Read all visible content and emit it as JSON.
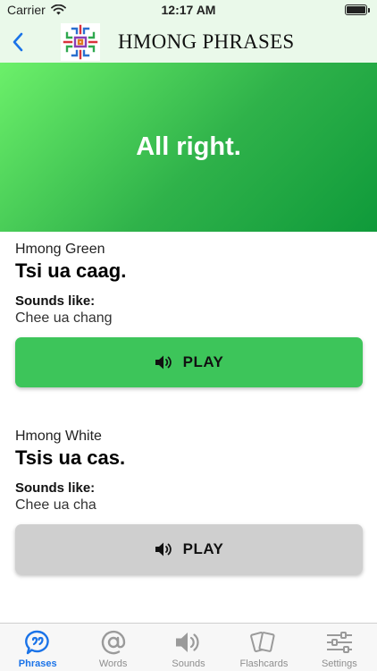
{
  "status_bar": {
    "carrier": "Carrier",
    "time": "12:17 AM"
  },
  "nav": {
    "title": "HMONG PHRASES"
  },
  "hero": {
    "phrase": "All right."
  },
  "sections": [
    {
      "dialect": "Hmong Green",
      "phrase": "Tsi ua caag.",
      "sounds_like_label": "Sounds like:",
      "sounds_like": "Chee ua chang",
      "play_label": "PLAY"
    },
    {
      "dialect": "Hmong White",
      "phrase": "Tsis ua cas.",
      "sounds_like_label": "Sounds like:",
      "sounds_like": "Chee ua cha",
      "play_label": "PLAY"
    }
  ],
  "tabs": [
    {
      "label": "Phrases",
      "icon": "chat-bubble-icon",
      "active": true
    },
    {
      "label": "Words",
      "icon": "at-sign-icon",
      "active": false
    },
    {
      "label": "Sounds",
      "icon": "speaker-icon",
      "active": false
    },
    {
      "label": "Flashcards",
      "icon": "cards-icon",
      "active": false
    },
    {
      "label": "Settings",
      "icon": "sliders-icon",
      "active": false
    }
  ],
  "colors": {
    "accent": "#1a73e8",
    "play_primary": "#3dc55a",
    "play_secondary": "#cfcfcf",
    "hero_start": "#6cf06a",
    "hero_end": "#0f9a3a"
  }
}
